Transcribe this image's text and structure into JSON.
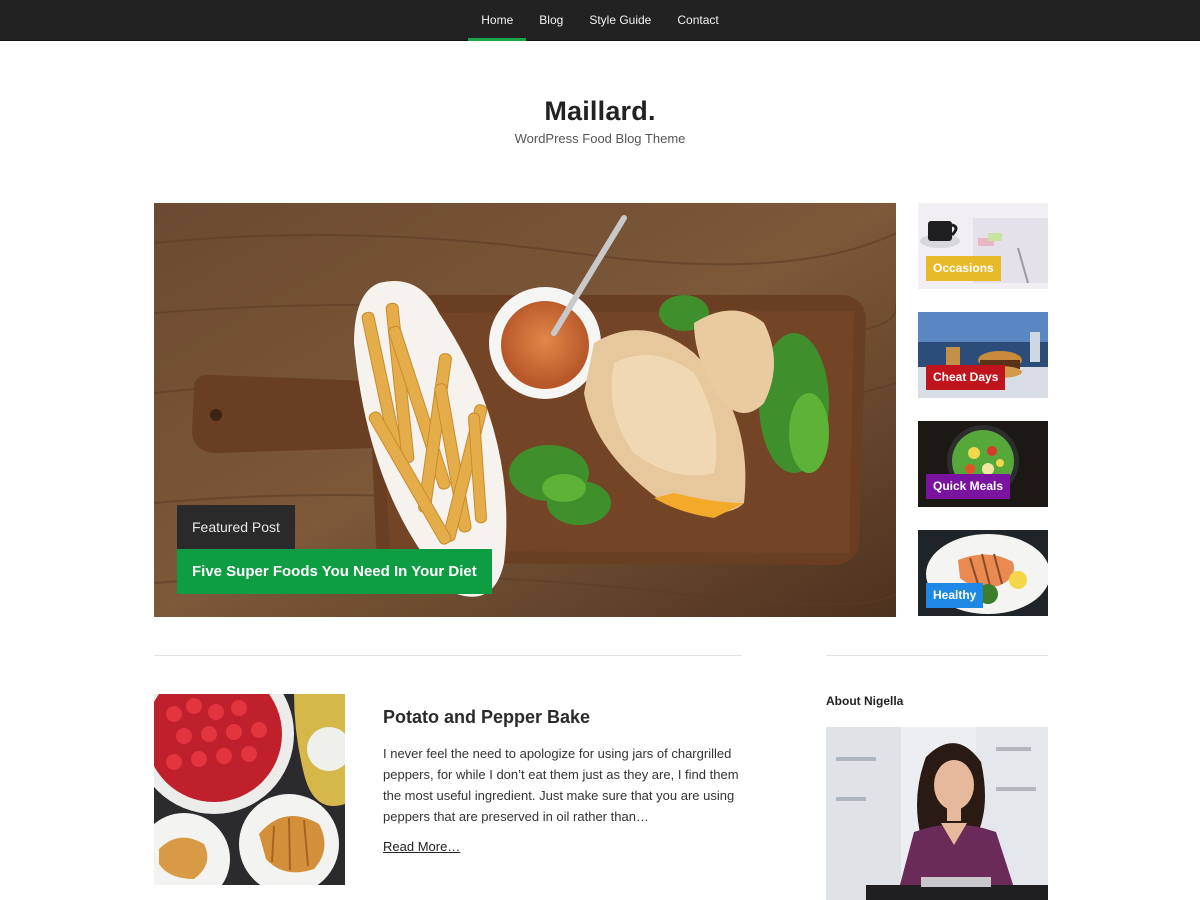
{
  "nav": {
    "items": [
      {
        "label": "Home"
      },
      {
        "label": "Blog"
      },
      {
        "label": "Style Guide"
      },
      {
        "label": "Contact"
      }
    ],
    "active_index": 0,
    "active_color": "#1aa44a"
  },
  "header": {
    "title": "Maillard.",
    "tagline": "WordPress Food Blog Theme"
  },
  "featured": {
    "tag": "Featured Post",
    "title": "Five Super Foods You Need In Your Diet",
    "title_color": "#0f9d43",
    "image_icon": "fries-and-sandwich-photo"
  },
  "categories": [
    {
      "label": "Occasions",
      "color": "#e8b928",
      "image_icon": "coffee-cup-photo"
    },
    {
      "label": "Cheat Days",
      "color": "#c0141c",
      "image_icon": "burger-photo"
    },
    {
      "label": "Quick Meals",
      "color": "#7a14a0",
      "image_icon": "salad-bowl-photo"
    },
    {
      "label": "Healthy",
      "color": "#1e88e5",
      "image_icon": "salmon-plate-photo"
    }
  ],
  "post": {
    "title": "Potato and Pepper Bake",
    "excerpt": "I never feel the need to apologize for using jars of chargrilled peppers, for while I don’t eat them just as they are, I find them the most useful ingredient. Just make sure that you are using peppers that are preserved in oil rather than…",
    "read_more": "Read More…",
    "image_icon": "strawberries-croissants-photo"
  },
  "sidebar": {
    "about_title": "About Nigella",
    "image_icon": "author-portrait-photo"
  }
}
